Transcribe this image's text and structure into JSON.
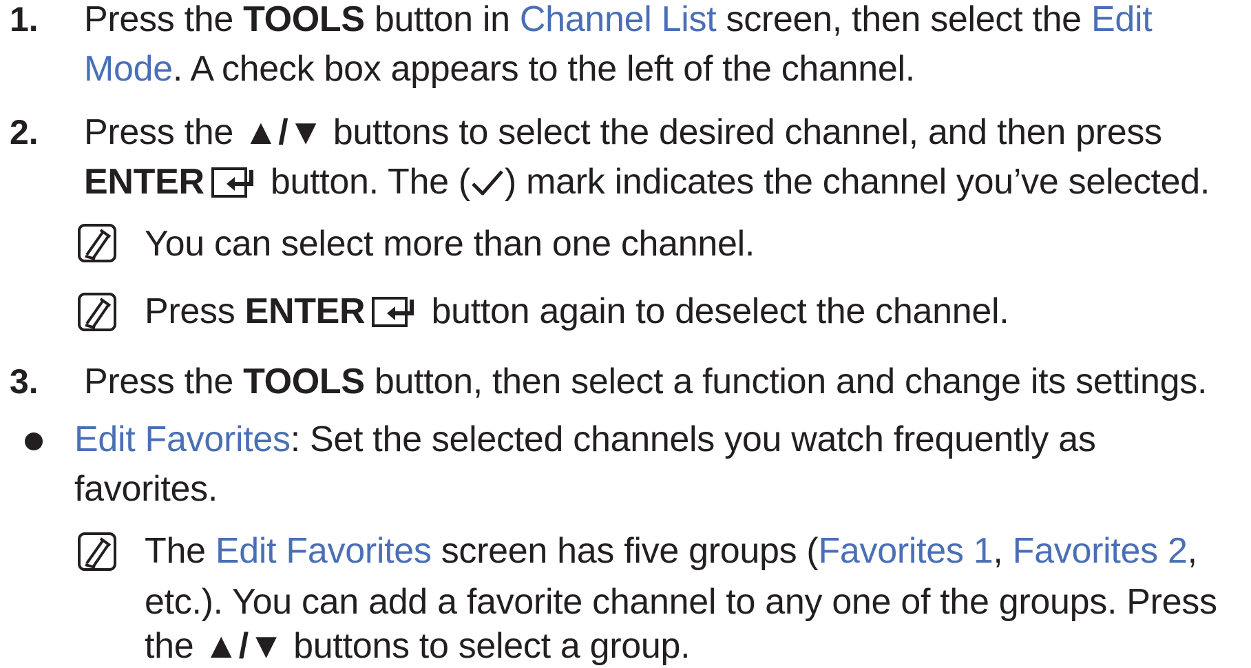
{
  "step1": {
    "number": "1.",
    "line1": {
      "t1": "Press the ",
      "tools": "TOOLS",
      "t2": " button in ",
      "channel_list": "Channel List",
      "t3": " screen, then select the ",
      "edit": "Edit"
    },
    "line2": {
      "mode": "Mode",
      "t1": ". A check box appears to the left of the channel."
    }
  },
  "step2": {
    "number": "2.",
    "line1": {
      "t1": "Press the ",
      "arrows": "▲/▼",
      "t2": " buttons to select the desired channel, and then press"
    },
    "line2": {
      "enter": "ENTER",
      "t1": " button. The (",
      "t2": ") mark indicates the channel you’ve selected."
    },
    "note1": "You can select more than one channel.",
    "note2": {
      "t1": "Press ",
      "enter": "ENTER",
      "t2": " button again to deselect the channel."
    }
  },
  "step3": {
    "number": "3.",
    "line1": {
      "t1": "Press the ",
      "tools": "TOOLS",
      "t2": " button, then select a function and change its settings."
    }
  },
  "bullet1": {
    "line1": {
      "term": "Edit Favorites",
      "t1": ": Set the selected channels you watch frequently as"
    },
    "line2": "favorites.",
    "note": {
      "line1": {
        "t1": "The ",
        "edit_favorites": "Edit Favorites",
        "t2": " screen has five groups (",
        "fav1": "Favorites 1",
        "t3": ", ",
        "fav2": "Favorites 2",
        "t4": ","
      },
      "line2": "etc.). You can add a favorite channel to any one of the groups. Press",
      "line3": {
        "t1": "the ",
        "arrows": "▲/▼",
        "t2": " buttons to select a group."
      }
    }
  },
  "colors": {
    "link": "#4a6fb5",
    "text": "#231f20"
  },
  "icons": {
    "note": "note-icon",
    "enter": "enter-icon",
    "check": "check-mark-icon"
  }
}
